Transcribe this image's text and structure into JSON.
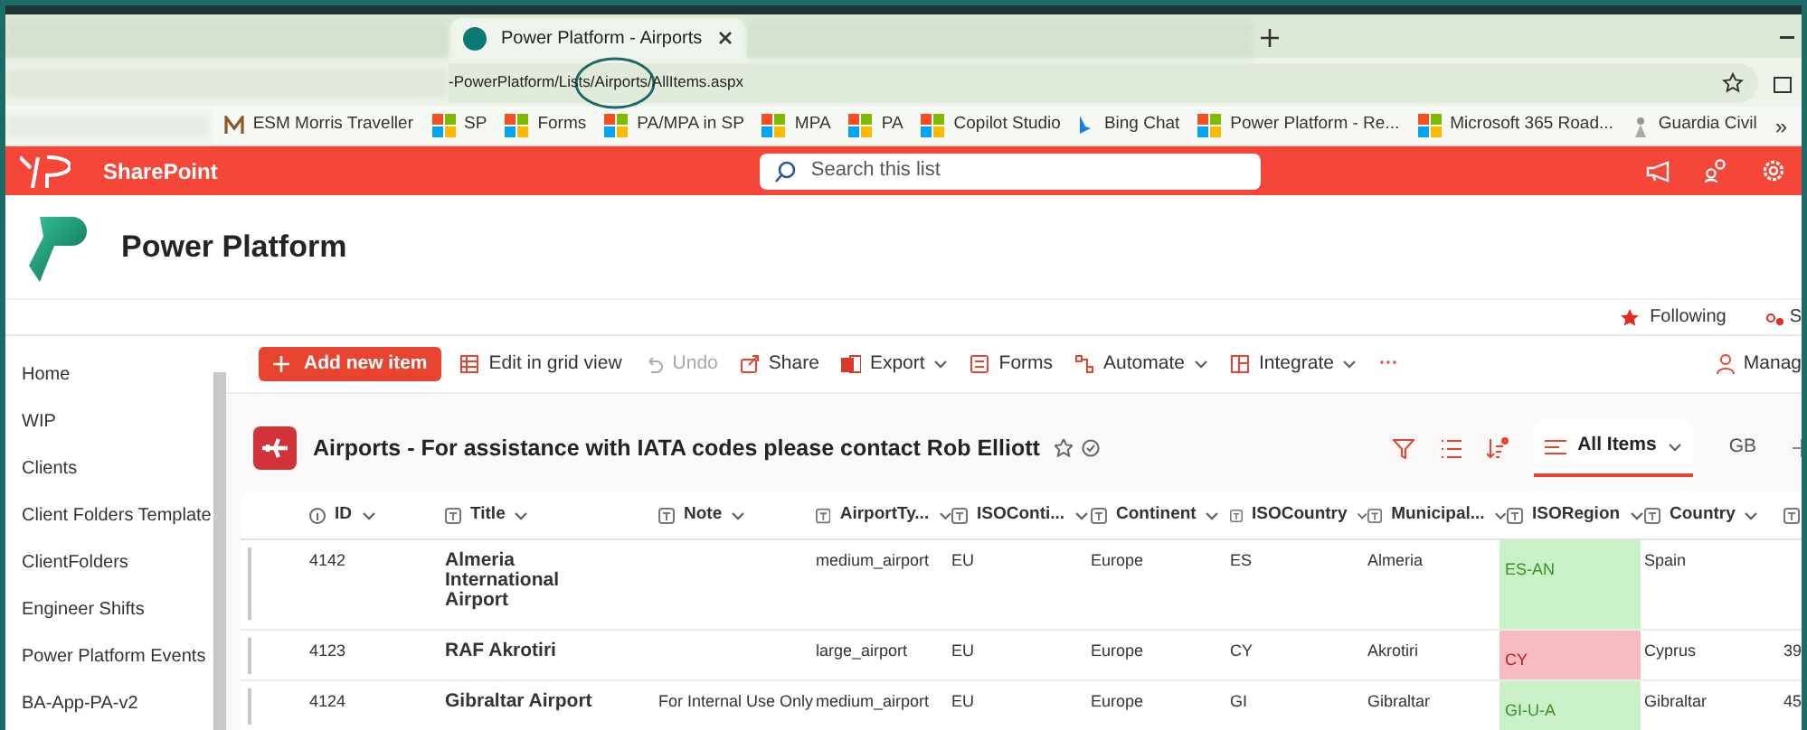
{
  "browser": {
    "active_tab": {
      "title": "Power Platform - Airports"
    },
    "address": "-PowerPlatform/Lists/Airports/AllItems.aspx",
    "bookmarks": [
      {
        "label": "ESM Morris Traveller",
        "kind": "m"
      },
      {
        "label": "SP",
        "kind": "ms"
      },
      {
        "label": "Forms",
        "kind": "ms"
      },
      {
        "label": "PA/MPA in SP",
        "kind": "ms"
      },
      {
        "label": "MPA",
        "kind": "ms"
      },
      {
        "label": "PA",
        "kind": "ms"
      },
      {
        "label": "Copilot Studio",
        "kind": "ms"
      },
      {
        "label": "Bing Chat",
        "kind": "bing"
      },
      {
        "label": "Power Platform - Re...",
        "kind": "ms"
      },
      {
        "label": "Microsoft 365 Road...",
        "kind": "ms"
      },
      {
        "label": "Guardia Civil",
        "kind": "figure"
      }
    ],
    "overflow": "»"
  },
  "suite_bar": {
    "app": "SharePoint",
    "search": {
      "placeholder": "Search this list"
    }
  },
  "site": {
    "title": "Power Platform",
    "following": "Following",
    "share": "S"
  },
  "sidebar": {
    "items": [
      "Home",
      "WIP",
      "Clients",
      "Client Folders Template",
      "ClientFolders",
      "Engineer Shifts",
      "Power Platform Events",
      "BA-App-PA-v2"
    ]
  },
  "command_bar": {
    "items": [
      {
        "label": "Add new item",
        "kind": "primary",
        "disabled": false
      },
      {
        "label": "Edit in grid view",
        "kind": "grid",
        "disabled": false
      },
      {
        "label": "Undo",
        "kind": "undo",
        "disabled": true
      },
      {
        "label": "Share",
        "kind": "share",
        "disabled": false
      },
      {
        "label": "Export",
        "kind": "export",
        "disabled": false,
        "dropdown": true
      },
      {
        "label": "Forms",
        "kind": "forms",
        "disabled": false
      },
      {
        "label": "Automate",
        "kind": "automate",
        "disabled": false,
        "dropdown": true
      },
      {
        "label": "Integrate",
        "kind": "integrate",
        "disabled": false,
        "dropdown": true
      },
      {
        "label": "···",
        "kind": "more",
        "disabled": false
      }
    ],
    "manage": "Manag"
  },
  "list": {
    "title": "Airports - For assistance with IATA codes please contact Rob Elliott",
    "views": [
      {
        "label": "All Items",
        "selected": true
      },
      {
        "label": "GB",
        "selected": false
      }
    ],
    "columns": [
      "ID",
      "Title",
      "Note",
      "AirportTy...",
      "ISOConti...",
      "Continent",
      "ISOCountry",
      "Municipal...",
      "ISORegion",
      "Country",
      ""
    ],
    "rows": [
      {
        "cells": [
          "4142",
          "Almeria International Airport",
          "",
          "medium_airport",
          "EU",
          "Europe",
          "ES",
          "Almeria",
          "ES-AN",
          "Spain",
          ""
        ],
        "color": "#c9f0c7"
      },
      {
        "cells": [
          "4123",
          "RAF Akrotiri",
          "",
          "large_airport",
          "EU",
          "Europe",
          "CY",
          "Akrotiri",
          "CY",
          "Cyprus",
          "39"
        ],
        "color": "#f7bcc2"
      },
      {
        "cells": [
          "4124",
          "Gibraltar Airport",
          "For Internal Use Only",
          "medium_airport",
          "EU",
          "Europe",
          "GI",
          "Gibraltar",
          "GI-U-A",
          "Gibraltar",
          "45"
        ],
        "color": "#c9f0c7"
      }
    ]
  }
}
